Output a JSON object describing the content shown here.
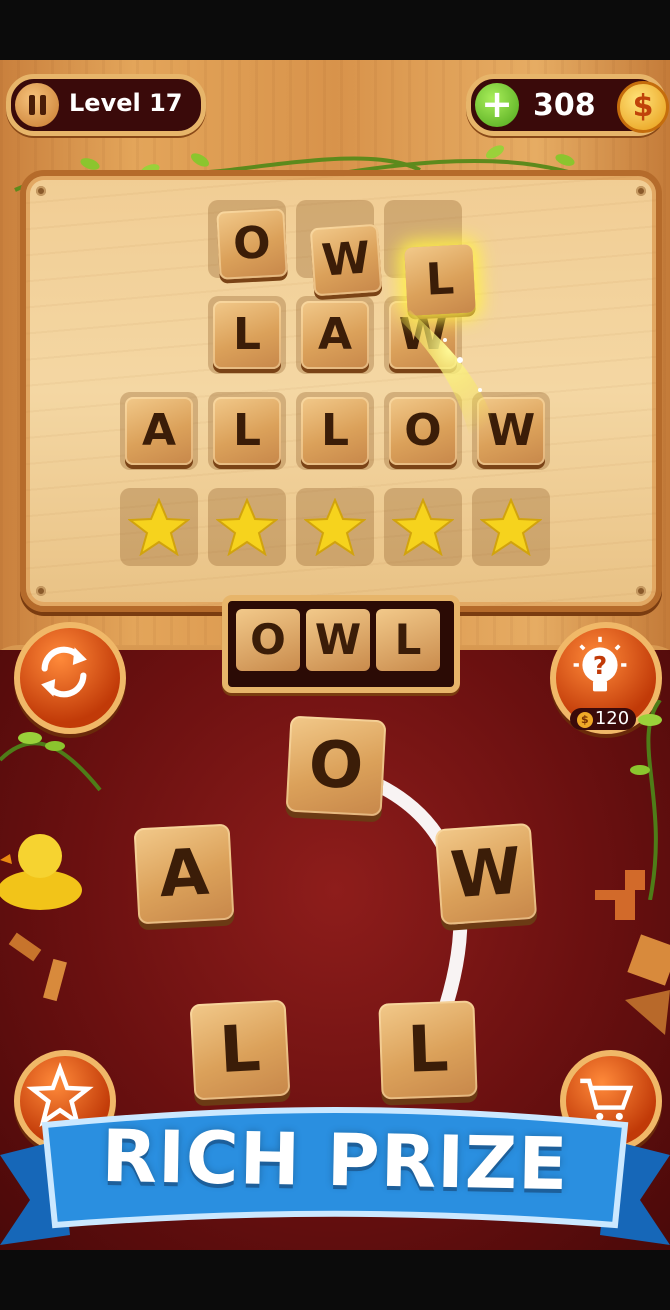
{
  "header": {
    "level_label": "Level 17",
    "coins": "308",
    "coin_symbol": "$",
    "plus_label": "+"
  },
  "puzzle": {
    "rows": [
      {
        "word": "OWL",
        "solved": true
      },
      {
        "word": "LAW",
        "solved": true
      },
      {
        "word": "ALLOW",
        "solved": true
      },
      {
        "word": "bonus-stars",
        "solved": false
      }
    ],
    "row1_letters": [
      "O",
      "W",
      "L"
    ],
    "row2_letters": [
      "L",
      "A",
      "W"
    ],
    "row3_letters": [
      "A",
      "L",
      "L",
      "O",
      "W"
    ],
    "stars_count": 5
  },
  "current_word": {
    "letters": [
      "O",
      "W",
      "L"
    ]
  },
  "wheel": {
    "letters": [
      "O",
      "A",
      "W",
      "L",
      "L"
    ]
  },
  "hint": {
    "cost": "120",
    "cost_symbol": "$"
  },
  "banner": {
    "text": "RICH PRIZE"
  },
  "colors": {
    "felt": "#7a1414",
    "wood": "#d8934b",
    "ribbon": "#2a8fe0",
    "gold": "#f6d31d"
  }
}
